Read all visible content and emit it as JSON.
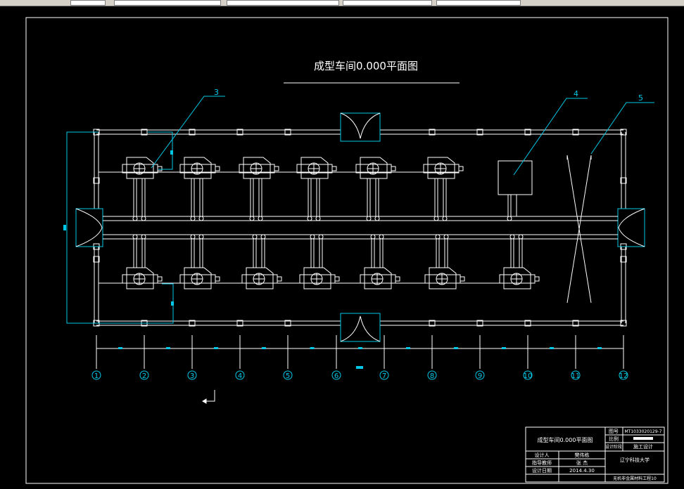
{
  "drawing": {
    "title": "成型车间0.000平面图",
    "callouts": [
      "3",
      "4",
      "5"
    ],
    "axis_labels": [
      "1",
      "2",
      "3",
      "4",
      "5",
      "6",
      "7",
      "8",
      "9",
      "10",
      "11",
      "12"
    ]
  },
  "title_block": {
    "drawing_name": "成型车间0.000平面图",
    "drawing_no_label": "图号",
    "drawing_no": "MT1033020129-7",
    "scale_label": "比例",
    "stage_label": "设计阶段",
    "stage_value": "施工设计",
    "designer_label": "设计人",
    "designer_name": "樊伟栋",
    "advisor_label": "指导教师",
    "advisor_name": "张 杰",
    "date_label": "设计日期",
    "date_value": "2014.4.30",
    "school": "辽宁科技大学",
    "class": "无机非金属材料工程10"
  },
  "colors": {
    "background": "#000000",
    "line": "#ffffff",
    "leader": "#00c8e6",
    "text": "#ffffff"
  }
}
